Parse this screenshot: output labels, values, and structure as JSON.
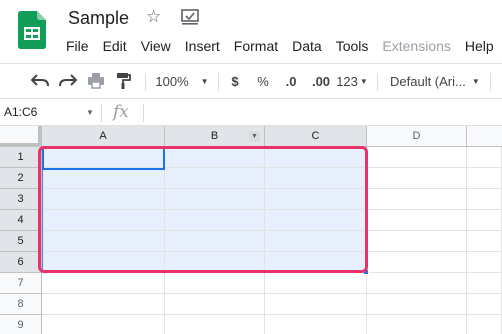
{
  "app": {
    "doc_title": "Sample",
    "logo_icon": "google-sheets-logo",
    "brand_color": "#0f9d58"
  },
  "menu": [
    {
      "label": "File",
      "disabled": false
    },
    {
      "label": "Edit",
      "disabled": false
    },
    {
      "label": "View",
      "disabled": false
    },
    {
      "label": "Insert",
      "disabled": false
    },
    {
      "label": "Format",
      "disabled": false
    },
    {
      "label": "Data",
      "disabled": false
    },
    {
      "label": "Tools",
      "disabled": false
    },
    {
      "label": "Extensions",
      "disabled": true
    },
    {
      "label": "Help",
      "disabled": false
    }
  ],
  "toolbar": {
    "zoom": "100%",
    "currency": "$",
    "percent": "%",
    "decrease_decimal": ".0",
    "increase_decimal": ".00",
    "more_formats": "123",
    "font": "Default (Ari..."
  },
  "formula_bar": {
    "name_box": "A1:C6",
    "fx": "fx",
    "value": ""
  },
  "sheet": {
    "columns": [
      "A",
      "B",
      "C",
      "D"
    ],
    "rows": [
      "1",
      "2",
      "3",
      "4",
      "5",
      "6",
      "7",
      "8",
      "9"
    ],
    "selection": "A1:C6",
    "active_cell": "A1",
    "highlight_color": "#e8336a",
    "selection_color": "#1a73e8"
  }
}
